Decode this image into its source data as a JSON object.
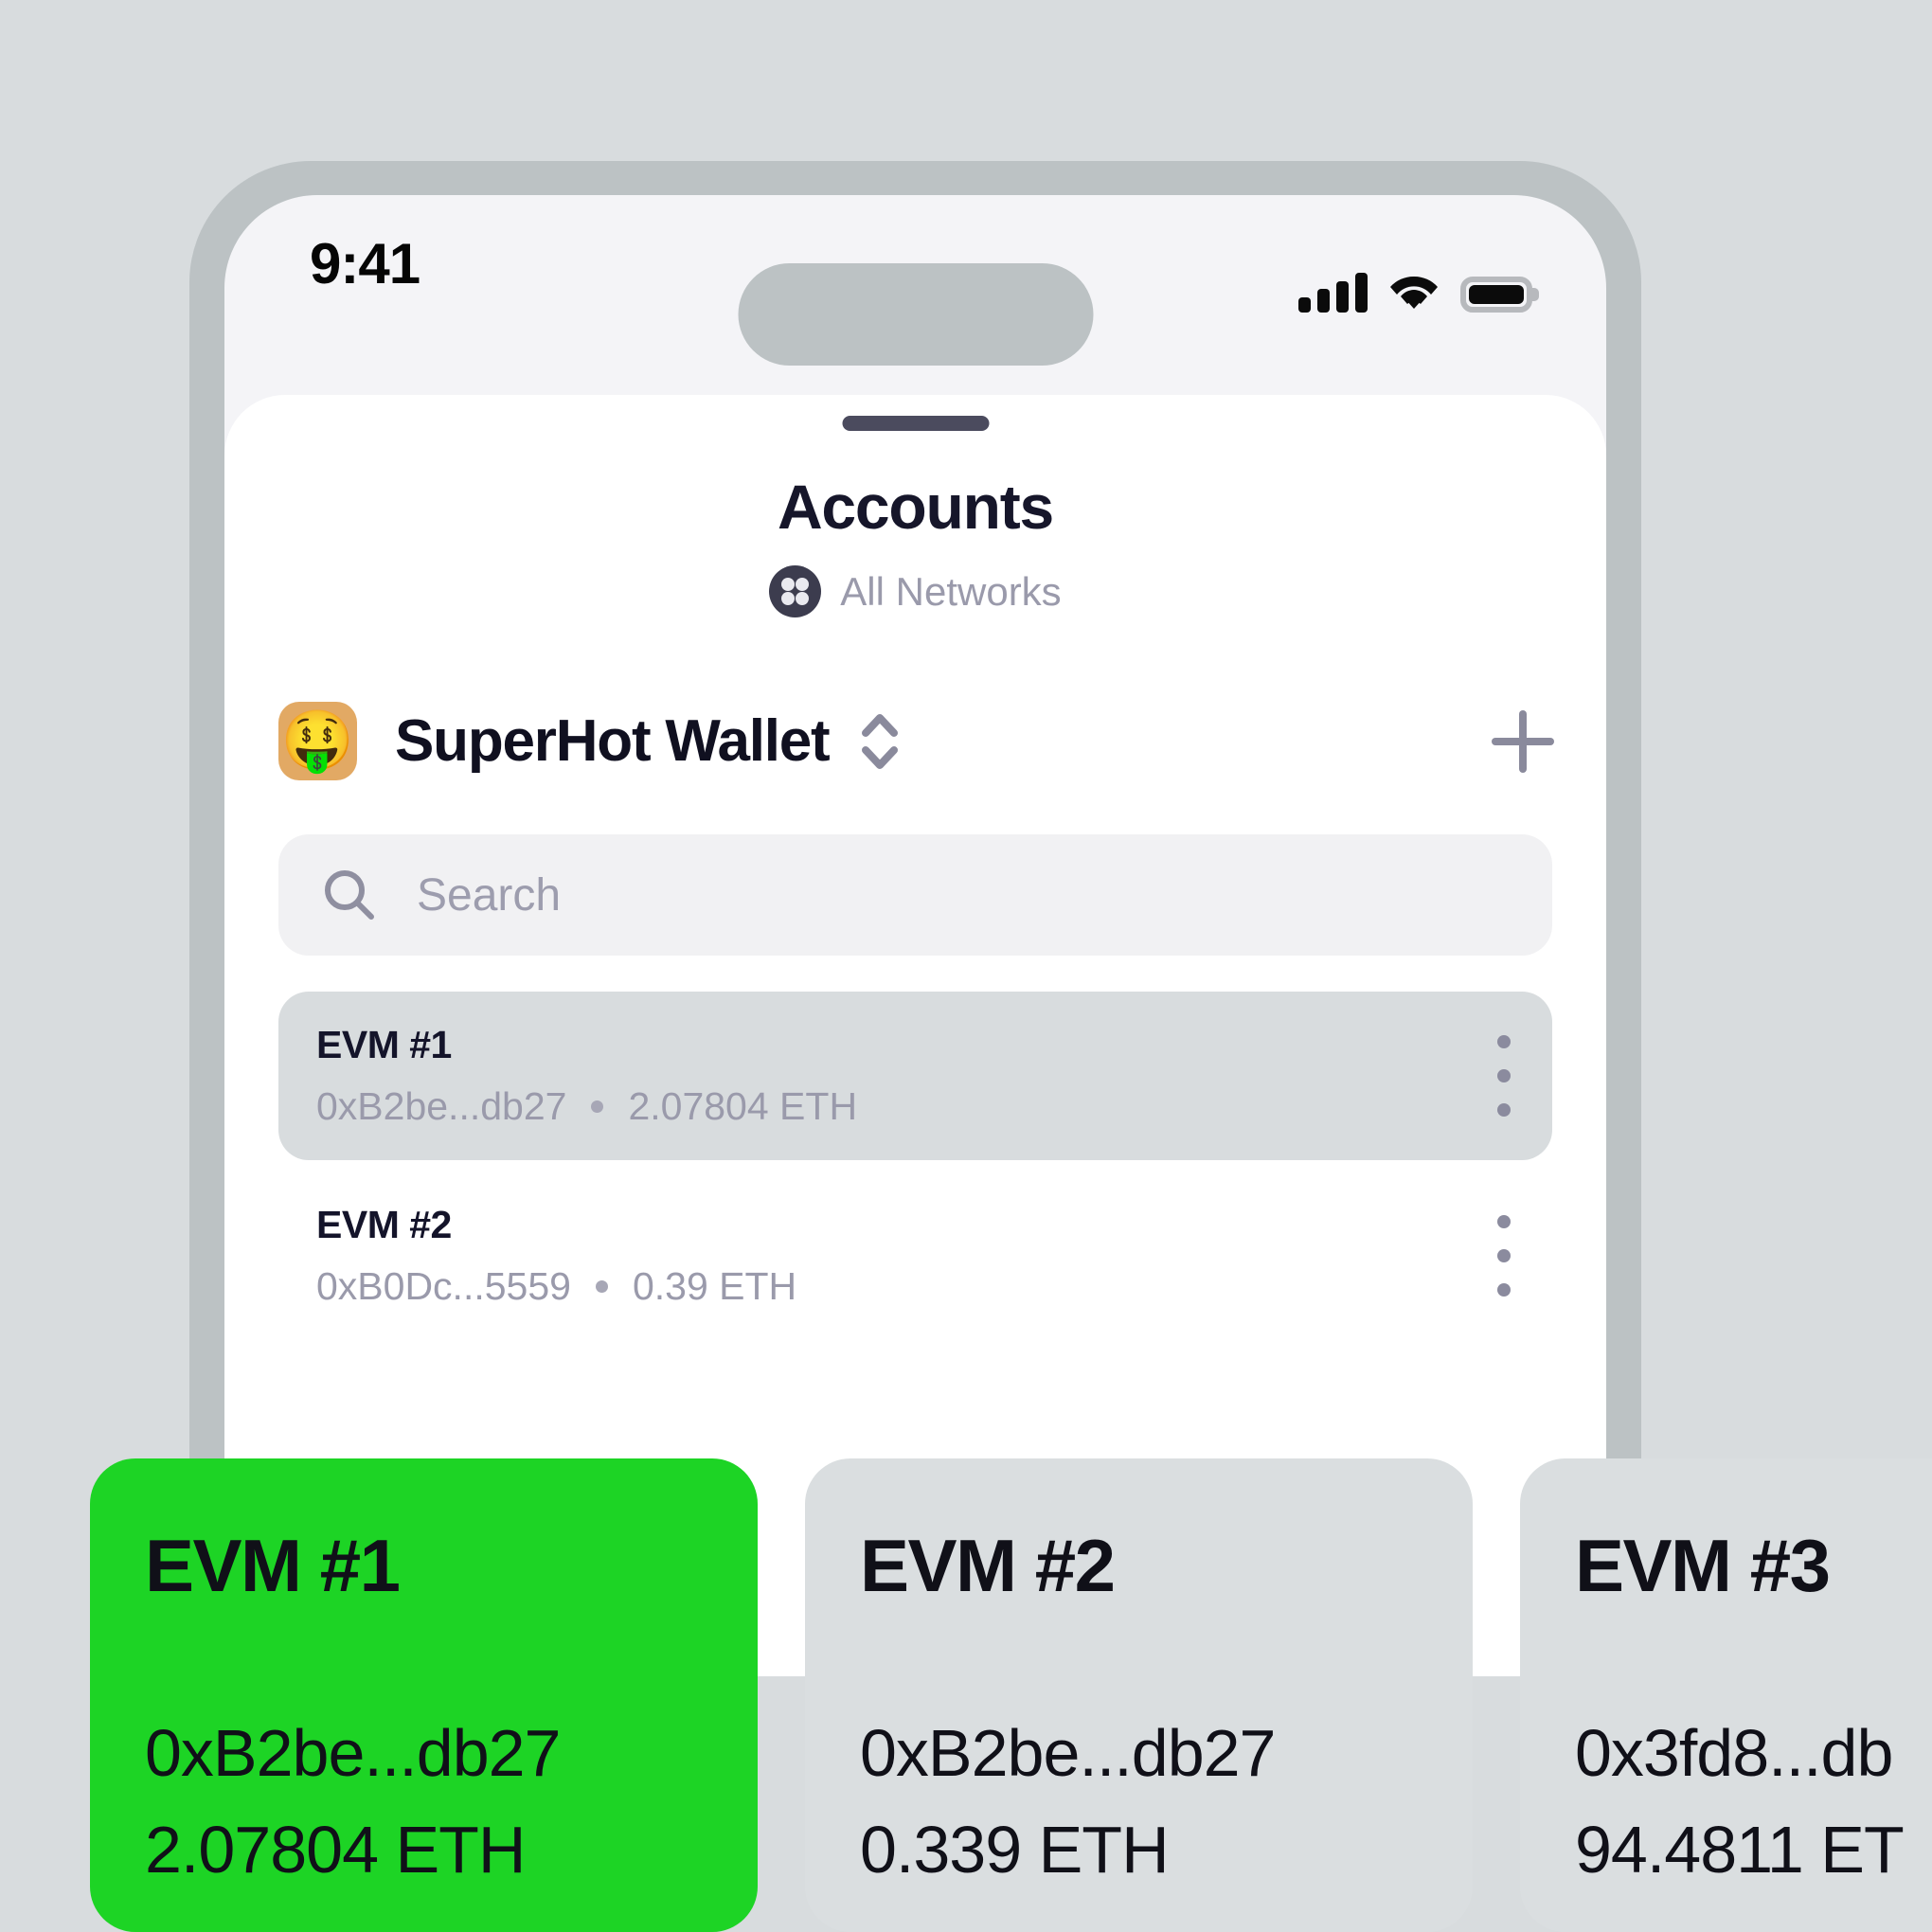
{
  "status_bar": {
    "time": "9:41",
    "signal_icon": "cellular-signal-icon",
    "wifi_icon": "wifi-icon",
    "battery_icon": "battery-full-icon"
  },
  "sheet": {
    "grabber": "sheet-grabber",
    "title": "Accounts",
    "network": {
      "badge_icon": "network-dots-icon",
      "label": "All Networks"
    }
  },
  "wallet": {
    "avatar_emoji": "🤑",
    "avatar_color": "#e2a964",
    "name": "SuperHot Wallet",
    "selector_icon": "chevron-up-down-icon",
    "add_label": "+"
  },
  "search": {
    "icon": "search-icon",
    "placeholder": "Search",
    "value": ""
  },
  "accounts": [
    {
      "name": "EVM #1",
      "address": "0xB2be...db27",
      "balance": "2.07804 ETH",
      "selected": true,
      "menu_icon": "kebab-menu-icon"
    },
    {
      "name": "EVM #2",
      "address": "0xB0Dc...5559",
      "balance": "0.39 ETH",
      "selected": false,
      "menu_icon": "kebab-menu-icon"
    }
  ],
  "cards": [
    {
      "title": "EVM #1",
      "address": "0xB2be...db27",
      "balance": "2.07804 ETH",
      "highlighted": true,
      "color": "#1dd425"
    },
    {
      "title": "EVM #2",
      "address": "0xB2be...db27",
      "balance": "0.339 ETH",
      "highlighted": false,
      "color": "#dadee0"
    },
    {
      "title": "EVM #3",
      "address": "0x3fd8...db",
      "balance": "94.4811 ET",
      "highlighted": false,
      "color": "#dadee0"
    }
  ],
  "colors": {
    "page_background": "#d8dcde",
    "phone_bezel": "#bcc2c4",
    "screen_background": "#f4f4f7",
    "sheet_background": "#ffffff",
    "accent_green": "#1dd425",
    "muted_text": "#9a9aab",
    "primary_text": "#14142a"
  }
}
